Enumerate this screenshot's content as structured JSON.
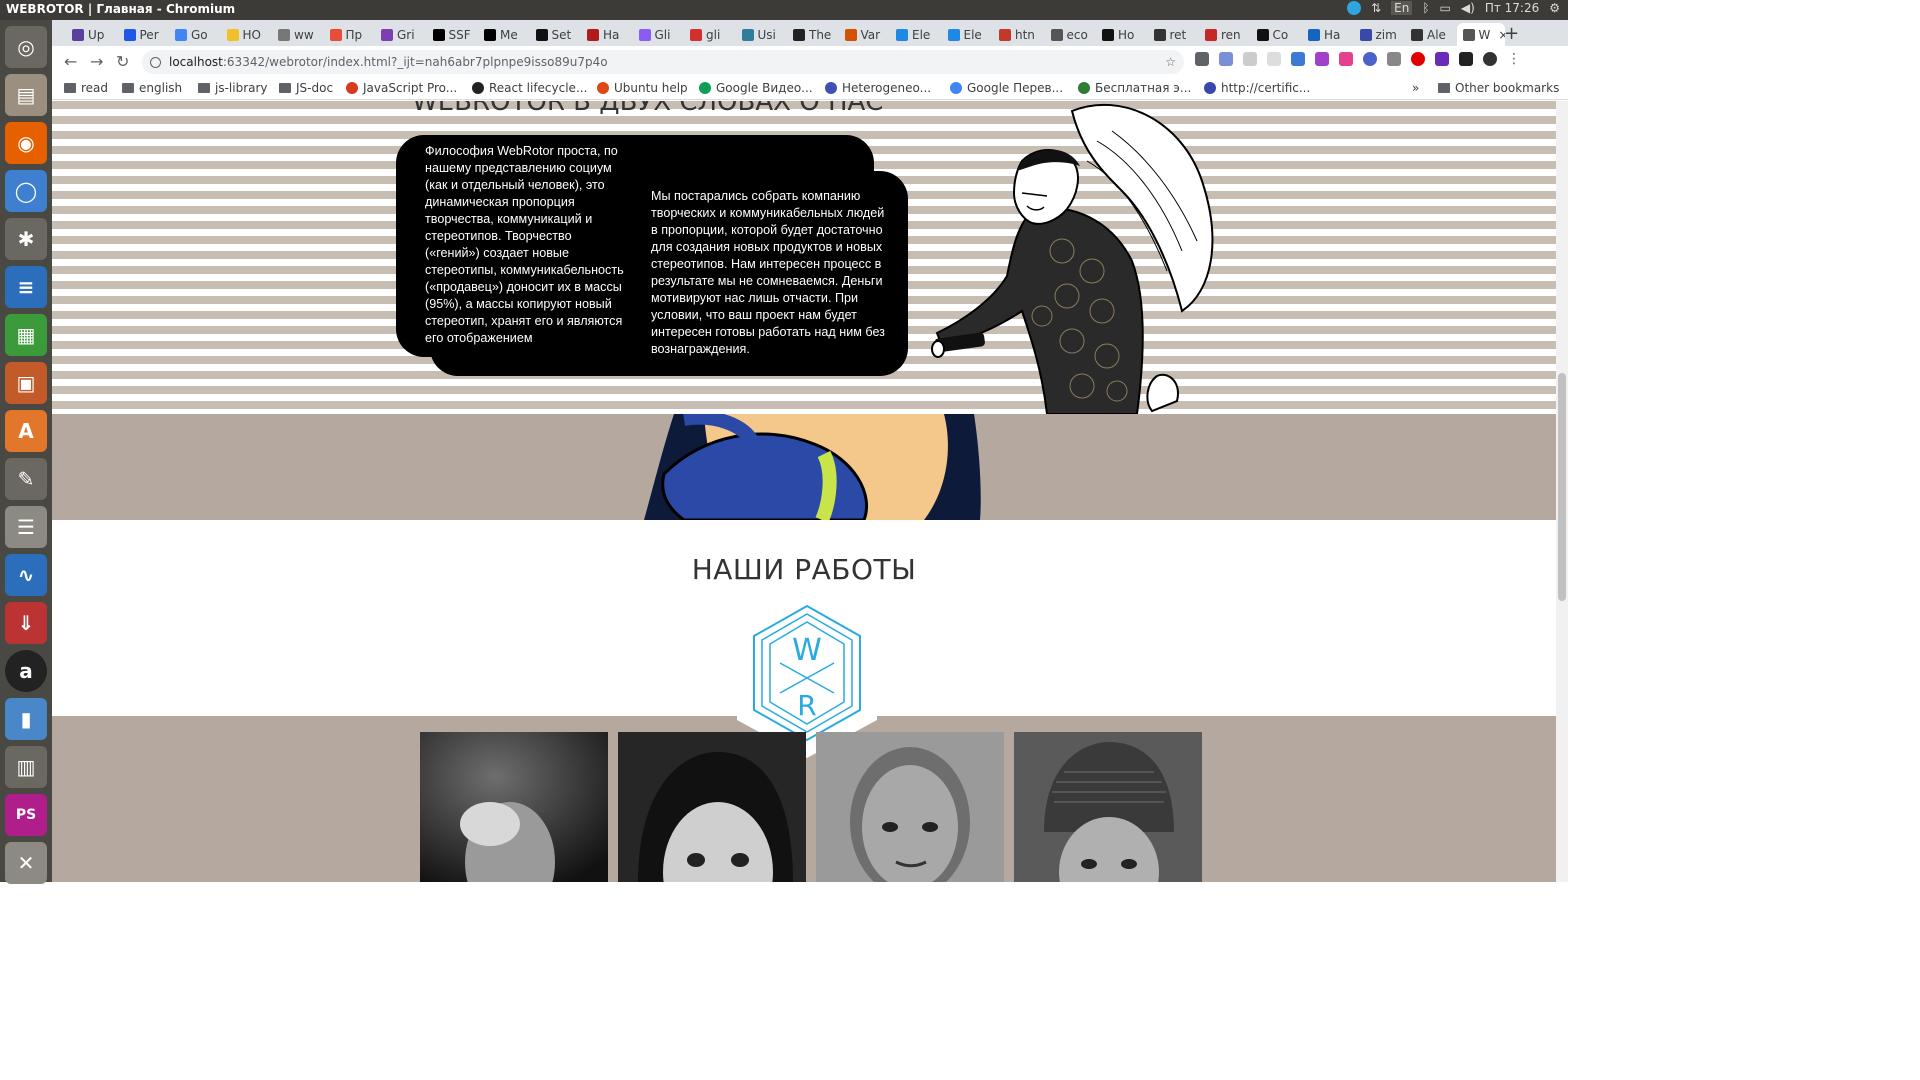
{
  "os": {
    "window_title": "WEBROTOR | Главная - Chromium",
    "keyboard_layout": "En",
    "clock": "Пт 17:26"
  },
  "tabs": [
    {
      "label": "Up",
      "color": "#5a3fa0"
    },
    {
      "label": "Per",
      "color": "#1f57e8"
    },
    {
      "label": "Go",
      "color": "#4285f4"
    },
    {
      "label": "HO",
      "color": "#f2c029"
    },
    {
      "label": "ww",
      "color": "#777777"
    },
    {
      "label": "Пр",
      "color": "#e74c3c"
    },
    {
      "label": "Gri",
      "color": "#7a3fb0"
    },
    {
      "label": "SSF",
      "color": "#000000"
    },
    {
      "label": "Me",
      "color": "#000000"
    },
    {
      "label": "Set",
      "color": "#111111"
    },
    {
      "label": "На",
      "color": "#b31b1b"
    },
    {
      "label": "Gli",
      "color": "#8a5cf5"
    },
    {
      "label": "gli",
      "color": "#d32f2f"
    },
    {
      "label": "Usi",
      "color": "#2e7d9a"
    },
    {
      "label": "The",
      "color": "#222222"
    },
    {
      "label": "Var",
      "color": "#d35400"
    },
    {
      "label": "Ele",
      "color": "#1e88e5"
    },
    {
      "label": "Ele",
      "color": "#1e88e5"
    },
    {
      "label": "htn",
      "color": "#c0392b"
    },
    {
      "label": "eco",
      "color": "#555555"
    },
    {
      "label": "Ho",
      "color": "#111111"
    },
    {
      "label": "ret",
      "color": "#333333"
    },
    {
      "label": "ren",
      "color": "#c62828"
    },
    {
      "label": "Co",
      "color": "#111111"
    },
    {
      "label": "Ha",
      "color": "#1565c0"
    },
    {
      "label": "zim",
      "color": "#3949ab"
    },
    {
      "label": "Ale",
      "color": "#333333"
    },
    {
      "label": "W",
      "color": "#555555"
    }
  ],
  "new_tab_label": "+",
  "address": {
    "host": "localhost",
    "path": ":63342/webrotor/index.html?_ijt=nah6abr7plpnpe9isso89u7p4o"
  },
  "bookmarks": [
    {
      "label": "read",
      "kind": "folder"
    },
    {
      "label": "english",
      "kind": "folder"
    },
    {
      "label": "js-library",
      "kind": "folder"
    },
    {
      "label": "JS-doc",
      "kind": "folder"
    },
    {
      "label": "JavaScript Pro...",
      "kind": "link",
      "color": "#d63a1f"
    },
    {
      "label": "React lifecycle...",
      "kind": "link",
      "color": "#222222"
    },
    {
      "label": "Ubuntu help",
      "kind": "link",
      "color": "#dd4814"
    },
    {
      "label": "Google Видео...",
      "kind": "link",
      "color": "#0f9d58"
    },
    {
      "label": "Heterogeneo...",
      "kind": "link",
      "color": "#3f51b5"
    },
    {
      "label": "Google Перев...",
      "kind": "link",
      "color": "#4285f4"
    },
    {
      "label": "Бесплатная э...",
      "kind": "link",
      "color": "#2e7d32"
    },
    {
      "label": "http://certific...",
      "kind": "link",
      "color": "#3949ab"
    }
  ],
  "bookmarks_overflow": "»",
  "other_bookmarks": "Other bookmarks",
  "page": {
    "band_title_partial": "WEBROTOR В ДВУХ СЛОВАХ О НАС",
    "bubble_text_1": "Философия WebRotor проста, по нашему представлению социум (как и отдельный человек), это динамическая пропорция творчества, коммуникаций и стереотипов. Творчество («гений») создает новые стереотипы, коммуникабельность («продавец») доносит их в массы (95%), а массы копируют новый стереотип, хранят его и являются его отображением",
    "bubble_text_2": "Мы постарались собрать компанию творческих и коммуникабельных людей в пропорции, которой будет достаточно для создания новых продуктов и новых стереотипов. Нам интересен процесс в результате мы не сомневаемся. Деньги мотивируют нас лишь отчасти. При условии, что ваш проект нам будет интересен готовы работать над ним без вознаграждения.",
    "works_title": "НАШИ РАБОТЫ",
    "logo_letters": {
      "top": "W",
      "bottom": "R"
    },
    "colors": {
      "stripe": "#c8bdb3",
      "band": "#b5a89f",
      "logo": "#29abe2"
    }
  }
}
